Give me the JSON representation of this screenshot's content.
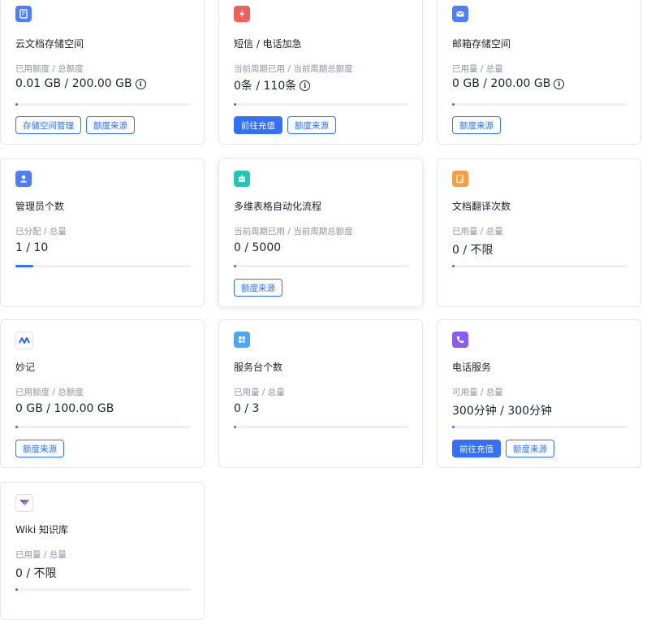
{
  "label_admin": "管理员个数",
  "cards": [
    {
      "title": "云文档存储空间",
      "sub": "已用额度 / 总额度",
      "value": "0.01 GB / 200.00 GB",
      "progress": 0.0001,
      "buttons": [
        "存储空间管理",
        "额度来源"
      ],
      "color": "#4e7dff",
      "icon": "doc-icon"
    },
    {
      "title": "短信 / 电话加急",
      "sub": "当前周期已用 / 当前周期总额度",
      "value": "0条 / 110条",
      "progress": 0,
      "buttons": [
        "前往充值",
        "额度来源"
      ],
      "color": "#f0605d",
      "icon": "lightning-icon"
    },
    {
      "title": "邮箱存储空间",
      "sub": "已用量 / 总量",
      "value": "0 GB / 200.00 GB",
      "progress": 0,
      "buttons": [
        "额度来源"
      ],
      "color": "#4e7dff",
      "icon": "mail-icon"
    },
    {
      "title": "管理员个数",
      "sub": "已分配 / 总量",
      "value": "1 / 10",
      "progress": 0.1,
      "buttons": [],
      "color": "#4e7dff",
      "icon": "user-icon"
    },
    {
      "title": "多维表格自动化流程",
      "sub": "当前周期已用 / 当前周期总额度",
      "value": "0 / 5000",
      "progress": 0,
      "buttons": [
        "额度来源"
      ],
      "color": "#1fc8b0",
      "icon": "robot-icon"
    },
    {
      "title": "文档翻译次数",
      "sub": "已用量 / 总量",
      "value": "0 / 不限",
      "progress": 0,
      "buttons": [],
      "color": "#ff9b38",
      "icon": "translate-icon"
    },
    {
      "title": "妙记",
      "sub": "已用额度 / 总额度",
      "value": "0 GB / 100.00 GB",
      "progress": 0,
      "buttons": [
        "额度来源"
      ],
      "color": "#2a6af6",
      "icon": "minutes-icon"
    },
    {
      "title": "服务台个数",
      "sub": "已用量 / 总量",
      "value": "0 / 3",
      "progress": 0,
      "buttons": [],
      "color": "#4ba8f5",
      "icon": "helpdesk-icon"
    },
    {
      "title": "电话服务",
      "sub": "可用量 / 总量",
      "value": "300分钟 / 300分钟",
      "progress": 0,
      "buttons": [
        "前往充值",
        "额度来源"
      ],
      "color": "#8a5cf5",
      "icon": "phone-icon"
    },
    {
      "title": "Wiki 知识库",
      "sub": "已用量 / 总量",
      "value": "0 / 不限",
      "progress": 0,
      "buttons": [],
      "color": "#e63c7b",
      "icon": "wiki-icon"
    }
  ]
}
